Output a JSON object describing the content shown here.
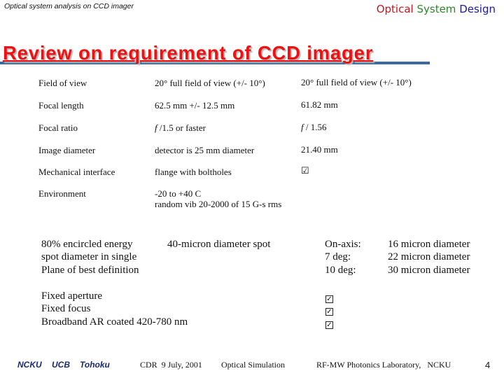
{
  "header": {
    "subtitle": "Optical system analysis on CCD imager",
    "brand": {
      "word1": "Optical",
      "word2": "System",
      "word3": "Design"
    },
    "title": "Review on requirement of CCD imager"
  },
  "requirements": [
    {
      "label": "Field of view",
      "requirement": "20° full field of view (+/- 10°)",
      "result": "20° full field of view (+/- 10°)"
    },
    {
      "label": "Focal length",
      "requirement": "62.5 mm +/- 12.5 mm",
      "result": "61.82 mm"
    },
    {
      "label": "Focal ratio",
      "requirement": "f /1.5 or faster",
      "result": "f / 1.56"
    },
    {
      "label": "Image diameter",
      "requirement": "detector is 25 mm diameter",
      "result": "21.40 mm"
    },
    {
      "label": "Mechanical interface",
      "requirement": "flange with boltholes",
      "result": "☑"
    },
    {
      "label": "Environment",
      "requirement": "-20 to +40 C",
      "requirement2": "random vib 20-2000 of 15 G-s rms"
    }
  ],
  "spot": {
    "label_lines": [
      "80% encircled energy",
      "spot diameter in single",
      "Plane of best definition"
    ],
    "requirement": "40-micron diameter spot",
    "results": [
      {
        "field": "On-axis:",
        "value": "16 micron diameter"
      },
      {
        "field": "7 deg:",
        "value": "22 micron diameter"
      },
      {
        "field": "10 deg:",
        "value": "30 micron diameter"
      }
    ]
  },
  "features": [
    {
      "label": "Fixed aperture",
      "check": "✓"
    },
    {
      "label": "Fixed focus",
      "check": "✓"
    },
    {
      "label": "Broadband AR coated 420-780 nm",
      "check": "✓"
    }
  ],
  "footer": {
    "org1": "NCKU",
    "org2": "UCB",
    "org3": "Tohoku",
    "event": "CDR  9 July, 2001",
    "topic": "Optical Simulation",
    "lab": "RF-MW Photonics Laboratory,   NCKU",
    "page": "4"
  }
}
